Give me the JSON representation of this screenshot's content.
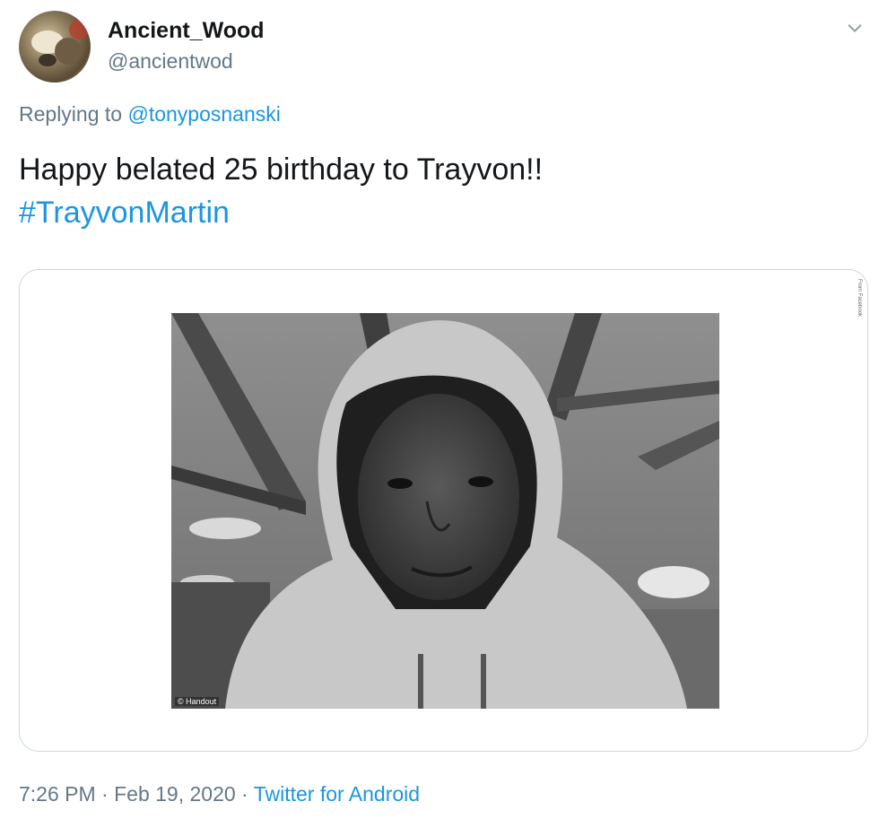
{
  "user": {
    "display_name": "Ancient_Wood",
    "handle": "@ancientwod"
  },
  "reply": {
    "prefix": "Replying to ",
    "mention": "@tonyposnanski"
  },
  "tweet": {
    "text": "Happy belated 25 birthday to Trayvon!!",
    "hashtag": "#TrayvonMartin"
  },
  "media": {
    "photo_credit": "© Handout",
    "side_credit": "From Facebook"
  },
  "meta": {
    "time": "7:26 PM",
    "separator1": " · ",
    "date": "Feb 19, 2020",
    "separator2": " · ",
    "source": "Twitter for Android"
  },
  "colors": {
    "link": "#1b95e0",
    "secondary_text": "#657786",
    "primary_text": "#14171a",
    "border": "#ccd6dd"
  },
  "icons": {
    "menu": "chevron-down-icon"
  }
}
